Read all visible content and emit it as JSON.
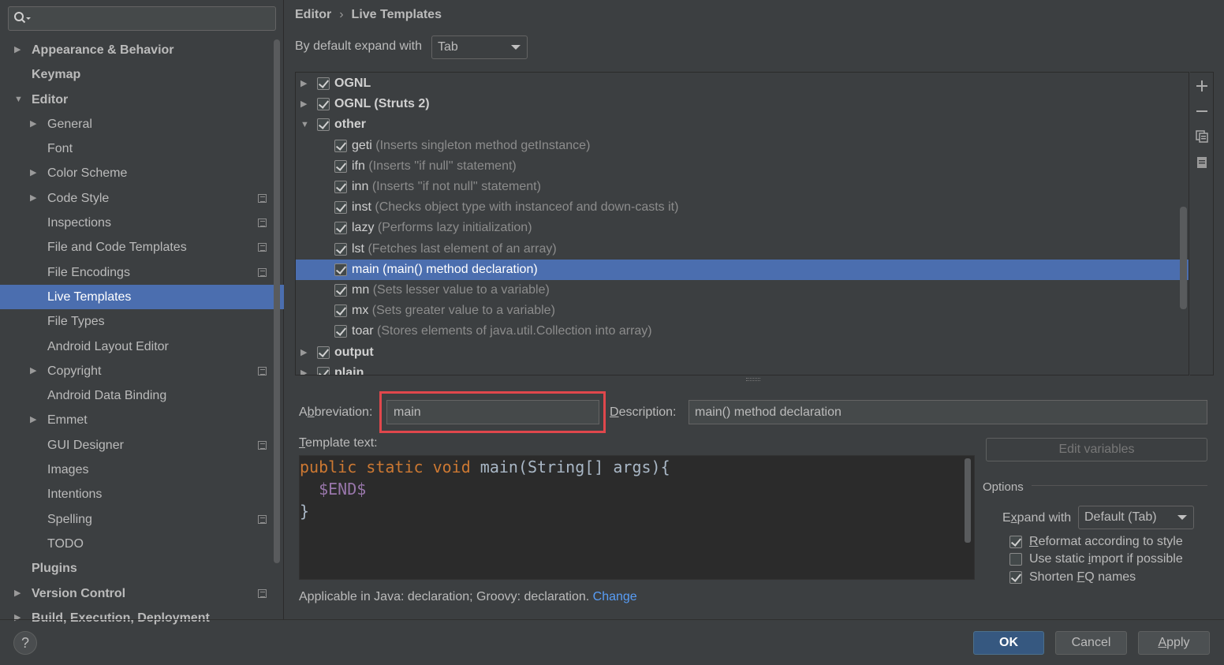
{
  "sidebar": {
    "search_placeholder": "",
    "items": [
      {
        "label": "Appearance & Behavior",
        "level": 0,
        "arrow": "collapsed",
        "bold": true,
        "proj": false
      },
      {
        "label": "Keymap",
        "level": 0,
        "arrow": "none",
        "bold": true,
        "proj": false
      },
      {
        "label": "Editor",
        "level": 0,
        "arrow": "expanded",
        "bold": true,
        "proj": false
      },
      {
        "label": "General",
        "level": 1,
        "arrow": "collapsed",
        "bold": false,
        "proj": false
      },
      {
        "label": "Font",
        "level": 1,
        "arrow": "none",
        "bold": false,
        "proj": false
      },
      {
        "label": "Color Scheme",
        "level": 1,
        "arrow": "collapsed",
        "bold": false,
        "proj": false
      },
      {
        "label": "Code Style",
        "level": 1,
        "arrow": "collapsed",
        "bold": false,
        "proj": true
      },
      {
        "label": "Inspections",
        "level": 1,
        "arrow": "none",
        "bold": false,
        "proj": true
      },
      {
        "label": "File and Code Templates",
        "level": 1,
        "arrow": "none",
        "bold": false,
        "proj": true
      },
      {
        "label": "File Encodings",
        "level": 1,
        "arrow": "none",
        "bold": false,
        "proj": true
      },
      {
        "label": "Live Templates",
        "level": 1,
        "arrow": "none",
        "bold": false,
        "proj": false,
        "selected": true
      },
      {
        "label": "File Types",
        "level": 1,
        "arrow": "none",
        "bold": false,
        "proj": false
      },
      {
        "label": "Android Layout Editor",
        "level": 1,
        "arrow": "none",
        "bold": false,
        "proj": false
      },
      {
        "label": "Copyright",
        "level": 1,
        "arrow": "collapsed",
        "bold": false,
        "proj": true
      },
      {
        "label": "Android Data Binding",
        "level": 1,
        "arrow": "none",
        "bold": false,
        "proj": false
      },
      {
        "label": "Emmet",
        "level": 1,
        "arrow": "collapsed",
        "bold": false,
        "proj": false
      },
      {
        "label": "GUI Designer",
        "level": 1,
        "arrow": "none",
        "bold": false,
        "proj": true
      },
      {
        "label": "Images",
        "level": 1,
        "arrow": "none",
        "bold": false,
        "proj": false
      },
      {
        "label": "Intentions",
        "level": 1,
        "arrow": "none",
        "bold": false,
        "proj": false
      },
      {
        "label": "Spelling",
        "level": 1,
        "arrow": "none",
        "bold": false,
        "proj": true
      },
      {
        "label": "TODO",
        "level": 1,
        "arrow": "none",
        "bold": false,
        "proj": false
      },
      {
        "label": "Plugins",
        "level": 0,
        "arrow": "none",
        "bold": true,
        "proj": false
      },
      {
        "label": "Version Control",
        "level": 0,
        "arrow": "collapsed",
        "bold": true,
        "proj": true
      },
      {
        "label": "Build, Execution, Deployment",
        "level": 0,
        "arrow": "collapsed",
        "bold": true,
        "proj": false
      }
    ]
  },
  "breadcrumb": {
    "parent": "Editor",
    "sep": "›",
    "current": "Live Templates"
  },
  "expand": {
    "label": "By default expand with",
    "value": "Tab"
  },
  "templates": [
    {
      "kind": "group",
      "name": "OGNL",
      "desc": "",
      "checked": true,
      "arrow": "collapsed"
    },
    {
      "kind": "group",
      "name": "OGNL (Struts 2)",
      "desc": "",
      "checked": true,
      "arrow": "collapsed"
    },
    {
      "kind": "group",
      "name": "other",
      "desc": "",
      "checked": true,
      "arrow": "expanded"
    },
    {
      "kind": "item",
      "name": "geti",
      "desc": "(Inserts singleton method getInstance)",
      "checked": true
    },
    {
      "kind": "item",
      "name": "ifn",
      "desc": "(Inserts ''if null'' statement)",
      "checked": true
    },
    {
      "kind": "item",
      "name": "inn",
      "desc": "(Inserts ''if not null'' statement)",
      "checked": true
    },
    {
      "kind": "item",
      "name": "inst",
      "desc": "(Checks object type with instanceof and down-casts it)",
      "checked": true
    },
    {
      "kind": "item",
      "name": "lazy",
      "desc": "(Performs lazy initialization)",
      "checked": true
    },
    {
      "kind": "item",
      "name": "lst",
      "desc": "(Fetches last element of an array)",
      "checked": true
    },
    {
      "kind": "item",
      "name": "main",
      "desc": "(main() method declaration)",
      "checked": true,
      "selected": true
    },
    {
      "kind": "item",
      "name": "mn",
      "desc": "(Sets lesser value to a variable)",
      "checked": true
    },
    {
      "kind": "item",
      "name": "mx",
      "desc": "(Sets greater value to a variable)",
      "checked": true
    },
    {
      "kind": "item",
      "name": "toar",
      "desc": "(Stores elements of java.util.Collection into array)",
      "checked": true
    },
    {
      "kind": "group",
      "name": "output",
      "desc": "",
      "checked": true,
      "arrow": "collapsed"
    },
    {
      "kind": "group",
      "name": "plain",
      "desc": "",
      "checked": true,
      "arrow": "collapsed"
    }
  ],
  "toolbar": {
    "add_icon": "plus-icon",
    "remove_icon": "minus-icon",
    "copy_icon": "copy-icon",
    "group_icon": "template-group-icon"
  },
  "editor": {
    "abbr_label_pre": "A",
    "abbr_label_mn": "b",
    "abbr_label_post": "breviation:",
    "abbr_value": "main",
    "desc_label_mn": "D",
    "desc_label_post": "escription:",
    "desc_value": "main() method declaration",
    "template_label_mn": "T",
    "template_label_post": "emplate text:",
    "code": {
      "line1_kw": "public static void",
      "line1_rest": " main(String[] args){",
      "line2_indent": "  ",
      "line2_var": "$END$",
      "line3": "}"
    },
    "edit_variables": "Edit variables",
    "options_title": "Options",
    "expand_with_pre": "E",
    "expand_with_mn": "x",
    "expand_with_post": "pand with",
    "expand_with_value": "Default (Tab)",
    "opt_reformat": {
      "mn": "R",
      "rest": "eformat according to style",
      "checked": true
    },
    "opt_static": {
      "pre": "Use static ",
      "mn": "i",
      "rest": "mport if possible",
      "checked": false
    },
    "opt_fq": {
      "pre": "Shorten ",
      "mn": "F",
      "rest": "Q names",
      "checked": true
    },
    "applicable_text": "Applicable in Java: declaration; Groovy: declaration.",
    "applicable_link": "Change"
  },
  "buttons": {
    "help": "?",
    "ok": "OK",
    "cancel": "Cancel",
    "apply_mn": "A",
    "apply_rest": "pply"
  },
  "colors": {
    "accent": "#4b6eaf",
    "highlight_box": "#e0474c",
    "keyword": "#cc7832",
    "variable": "#9876aa",
    "link": "#589df6"
  }
}
